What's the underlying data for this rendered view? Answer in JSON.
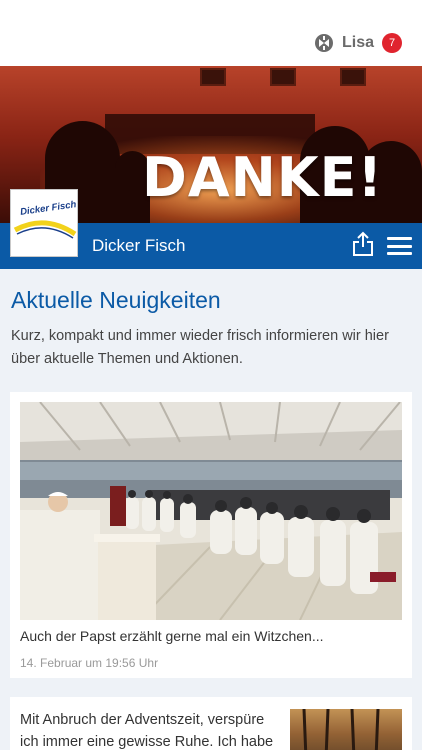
{
  "topbar": {
    "user_name": "Lisa",
    "notification_count": "7",
    "badge_color": "#e0242e"
  },
  "hero": {
    "banner_text": "DANKE!"
  },
  "bluebar": {
    "title": "Dicker Fisch",
    "color": "#0b5aa6",
    "share_icon": "share-icon",
    "menu_icon": "hamburger-menu-icon"
  },
  "brand_logo": {
    "text": "Dicker Fisch"
  },
  "news": {
    "heading": "Aktuelle Neuigkeiten",
    "intro": "Kurz, kompakt und immer wieder frisch informieren wir hier über aktuelle Themen und Aktionen.",
    "items": [
      {
        "caption": "Auch der Papst erzählt gerne mal ein Witzchen...",
        "date": "14. Februar um 19:56 Uhr"
      },
      {
        "text": "Mit Anbruch der Adventszeit, verspüre ich immer eine gewisse Ruhe. Ich habe ganz"
      }
    ]
  }
}
